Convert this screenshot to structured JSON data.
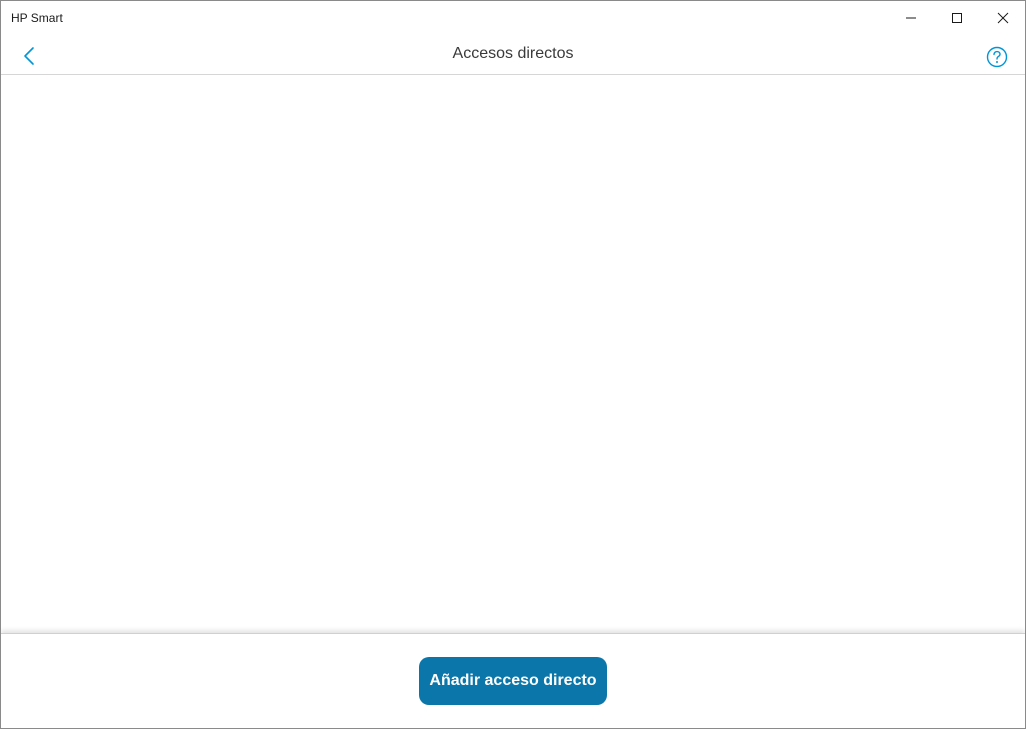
{
  "window": {
    "app_title": "HP Smart"
  },
  "header": {
    "title": "Accesos directos",
    "back_icon": "chevron-left-icon",
    "help_icon": "question-circle-icon"
  },
  "footer": {
    "add_button_label": "Añadir acceso directo"
  },
  "colors": {
    "accent": "#0a76aa",
    "icon_blue": "#0096d6"
  }
}
